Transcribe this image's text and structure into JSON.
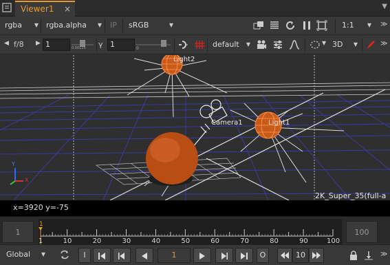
{
  "tabs": {
    "active_label": "Viewer1",
    "close_glyph": "×"
  },
  "toolbar_top": {
    "channels": "rgba",
    "alpha_channel": "rgba.alpha",
    "ip_label": "IP",
    "lut": "sRGB",
    "zoom": "1:1"
  },
  "toolbar_second": {
    "fstop": "f/8",
    "gain_value": "1",
    "gain_slider_min": "0.00125",
    "gamma_label": "γ",
    "gamma_value": "1",
    "gamma_slider_min": "0",
    "viewer_process": "default",
    "view_mode": "3D"
  },
  "viewport": {
    "light2_label": "Light2",
    "camera_label": "Camera1",
    "light1_label": "Light1",
    "format_label": "2K_Super_35(full-a",
    "axis_y": "Y",
    "axis_x": "X",
    "grid_color": "#3a3aa0",
    "light_color": "#e0641e"
  },
  "info": {
    "coords": "x=3920 y=-75"
  },
  "timeline": {
    "in_frame": "1",
    "out_frame": "100",
    "current_frame_marker": "1",
    "ticks": [
      "1",
      "10",
      "20",
      "30",
      "40",
      "50",
      "60",
      "70",
      "80",
      "90",
      "100"
    ]
  },
  "controls": {
    "scope": "Global",
    "i_label": "I",
    "current_frame": "1",
    "o_label": "O",
    "skip_increment": "10"
  },
  "colors": {
    "accent": "#e89a2c",
    "background": "#323232"
  }
}
